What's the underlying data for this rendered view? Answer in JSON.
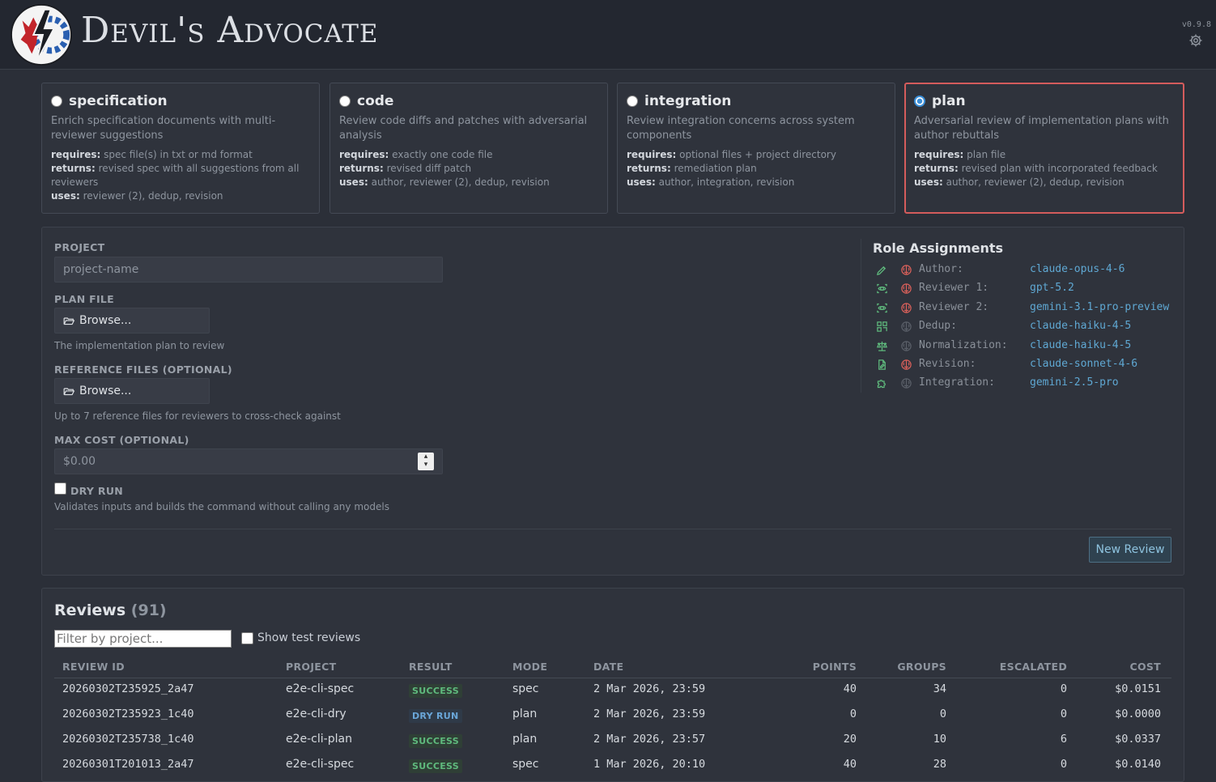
{
  "app": {
    "title": "Devil's Advocate",
    "version": "v0.9.8"
  },
  "modes": [
    {
      "name": "specification",
      "selected": false,
      "desc": "Enrich specification documents with multi-reviewer suggestions",
      "requires_label": "requires:",
      "requires": "spec file(s) in txt or md format",
      "returns_label": "returns:",
      "returns": "revised spec with all suggestions from all reviewers",
      "uses_label": "uses:",
      "uses": "reviewer (2), dedup, revision"
    },
    {
      "name": "code",
      "selected": false,
      "desc": "Review code diffs and patches with adversarial analysis",
      "requires_label": "requires:",
      "requires": "exactly one code file",
      "returns_label": "returns:",
      "returns": "revised diff patch",
      "uses_label": "uses:",
      "uses": "author, reviewer (2), dedup, revision"
    },
    {
      "name": "integration",
      "selected": false,
      "desc": "Review integration concerns across system components",
      "requires_label": "requires:",
      "requires": "optional files + project directory",
      "returns_label": "returns:",
      "returns": "remediation plan",
      "uses_label": "uses:",
      "uses": "author, integration, revision"
    },
    {
      "name": "plan",
      "selected": true,
      "desc": "Adversarial review of implementation plans with author rebuttals",
      "requires_label": "requires:",
      "requires": "plan file",
      "returns_label": "returns:",
      "returns": "revised plan with incorporated feedback",
      "uses_label": "uses:",
      "uses": "author, reviewer (2), dedup, revision"
    }
  ],
  "form": {
    "project_label": "PROJECT",
    "project_placeholder": "project-name",
    "plan_file_label": "PLAN FILE",
    "browse_label": "Browse...",
    "plan_hint": "The implementation plan to review",
    "ref_files_label": "REFERENCE FILES (OPTIONAL)",
    "ref_hint": "Up to 7 reference files for reviewers to cross-check against",
    "max_cost_label": "MAX COST (OPTIONAL)",
    "max_cost_placeholder": "$0.00",
    "dry_run_label": "DRY RUN",
    "dry_run_hint": "Validates inputs and builds the command without calling any models",
    "new_review_label": "New Review"
  },
  "roles": {
    "title": "Role Assignments",
    "items": [
      {
        "name": "Author:",
        "model": "claude-opus-4-6",
        "icon": "pen-icon",
        "brain_active": true
      },
      {
        "name": "Reviewer 1:",
        "model": "gpt-5.2",
        "icon": "scan-eye-icon",
        "brain_active": true
      },
      {
        "name": "Reviewer 2:",
        "model": "gemini-3.1-pro-preview",
        "icon": "scan-eye-icon",
        "brain_active": true
      },
      {
        "name": "Dedup:",
        "model": "claude-haiku-4-5",
        "icon": "grid-icon",
        "brain_active": false
      },
      {
        "name": "Normalization:",
        "model": "claude-haiku-4-5",
        "icon": "scale-icon",
        "brain_active": false
      },
      {
        "name": "Revision:",
        "model": "claude-sonnet-4-6",
        "icon": "file-edit-icon",
        "brain_active": true
      },
      {
        "name": "Integration:",
        "model": "gemini-2.5-pro",
        "icon": "puzzle-icon",
        "brain_active": false
      }
    ],
    "colors": {
      "icon": "#5fba7d",
      "brain_on": "#d9605a",
      "brain_off": "#5a5f68"
    }
  },
  "reviews": {
    "title": "Reviews",
    "count": "(91)",
    "filter_placeholder": "Filter by project...",
    "show_test_label": "Show test reviews",
    "columns": [
      "REVIEW ID",
      "PROJECT",
      "RESULT",
      "MODE",
      "DATE",
      "POINTS",
      "GROUPS",
      "ESCALATED",
      "COST"
    ],
    "rows": [
      {
        "id": "20260302T235925_2a47",
        "project": "e2e-cli-spec",
        "result": "SUCCESS",
        "mode": "spec",
        "date": "2 Mar 2026, 23:59",
        "points": "40",
        "groups": "34",
        "escalated": "0",
        "cost": "$0.0151"
      },
      {
        "id": "20260302T235923_1c40",
        "project": "e2e-cli-dry",
        "result": "DRY RUN",
        "mode": "plan",
        "date": "2 Mar 2026, 23:59",
        "points": "0",
        "groups": "0",
        "escalated": "0",
        "cost": "$0.0000"
      },
      {
        "id": "20260302T235738_1c40",
        "project": "e2e-cli-plan",
        "result": "SUCCESS",
        "mode": "plan",
        "date": "2 Mar 2026, 23:57",
        "points": "20",
        "groups": "10",
        "escalated": "6",
        "cost": "$0.0337"
      },
      {
        "id": "20260301T201013_2a47",
        "project": "e2e-cli-spec",
        "result": "SUCCESS",
        "mode": "spec",
        "date": "1 Mar 2026, 20:10",
        "points": "40",
        "groups": "28",
        "escalated": "0",
        "cost": "$0.0140"
      }
    ]
  }
}
